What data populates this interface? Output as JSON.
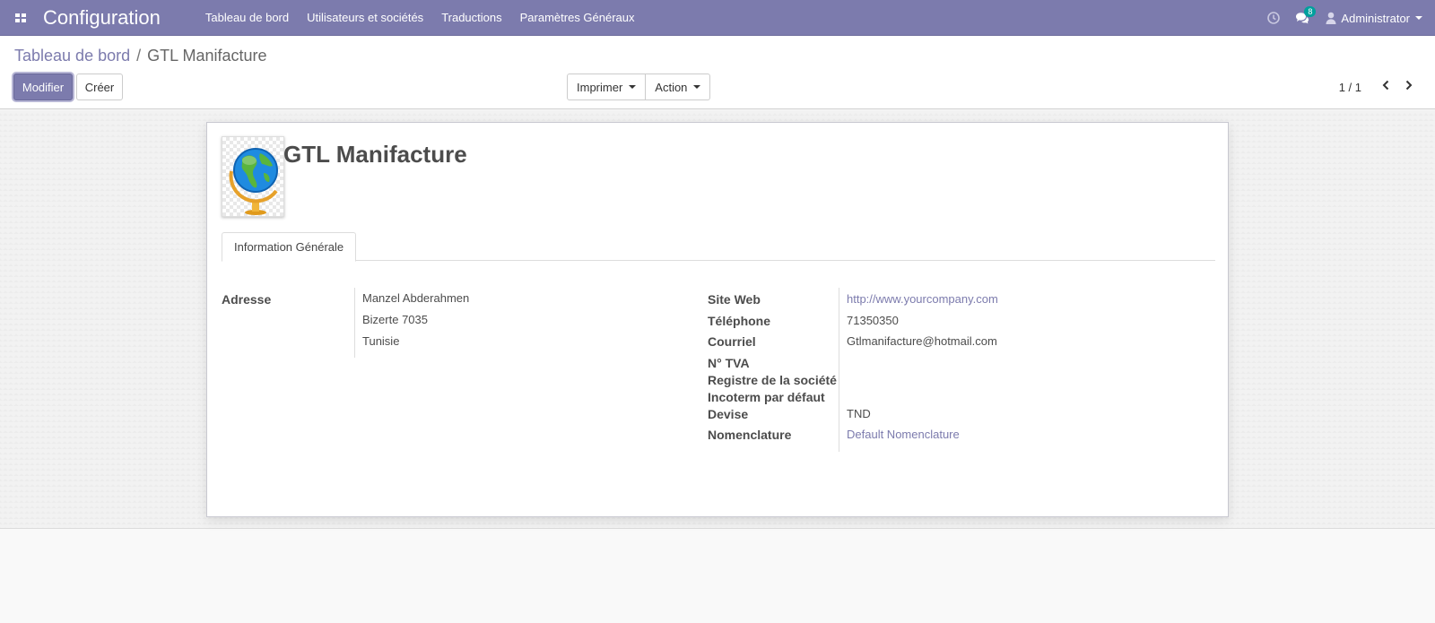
{
  "navbar": {
    "app_title": "Configuration",
    "menu": [
      {
        "label": "Tableau de bord"
      },
      {
        "label": "Utilisateurs et sociétés"
      },
      {
        "label": "Traductions"
      },
      {
        "label": "Paramètres Généraux"
      }
    ],
    "messages_count": "8",
    "user_name": "Administrator"
  },
  "breadcrumb": {
    "parent": "Tableau de bord",
    "separator": "/",
    "current": "GTL Manifacture"
  },
  "buttons": {
    "edit": "Modifier",
    "create": "Créer",
    "print": "Imprimer",
    "action": "Action"
  },
  "pager": {
    "value": "1 / 1"
  },
  "form": {
    "company_name": "GTL Manifacture",
    "tab_label": "Information Générale",
    "address_label": "Adresse",
    "address_lines": [
      "Manzel Abderahmen",
      "Bizerte  7035",
      "Tunisie"
    ],
    "fields": [
      {
        "label": "Site Web",
        "value": "http://www.yourcompany.com"
      },
      {
        "label": "Téléphone",
        "value": "71350350"
      },
      {
        "label": "Courriel",
        "value": "Gtlmanifacture@hotmail.com"
      },
      {
        "label": "N° TVA",
        "value": ""
      },
      {
        "label": "Registre de la société",
        "value": ""
      },
      {
        "label": "Incoterm par défaut",
        "value": ""
      },
      {
        "label": "Devise",
        "value": "TND"
      },
      {
        "label": "Nomenclature",
        "value": "Default Nomenclature"
      }
    ]
  },
  "colors": {
    "brand": "#7c7bad",
    "badge": "#00a09d"
  }
}
